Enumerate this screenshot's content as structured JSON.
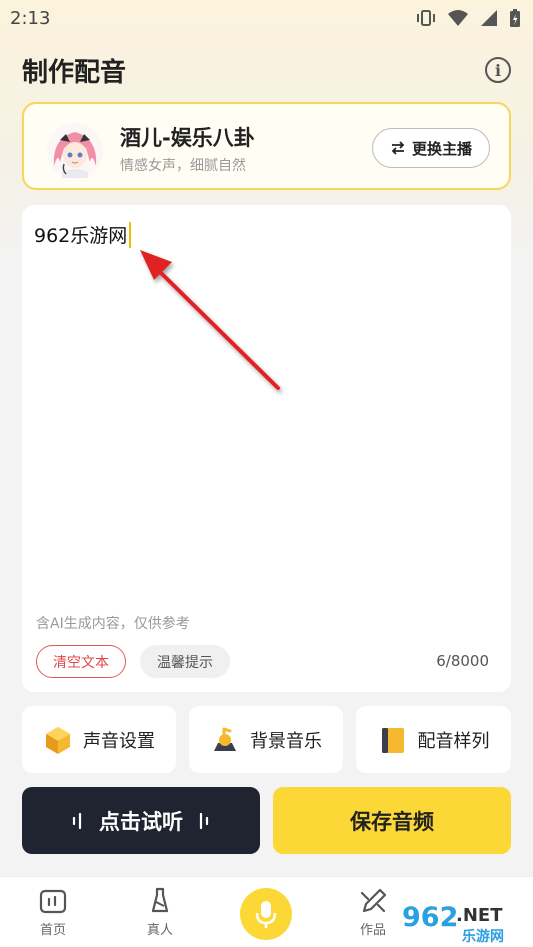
{
  "status_bar": {
    "time": "2:13"
  },
  "header": {
    "title": "制作配音",
    "info_label": "i"
  },
  "anchor": {
    "name": "酒儿-娱乐八卦",
    "description": "情感女声，细腻自然",
    "switch_label": "更换主播",
    "switch_icon": "swap-icon"
  },
  "editor": {
    "text": "962乐游网",
    "ai_note": "含AI生成内容，仅供参考",
    "clear_label": "清空文本",
    "tips_label": "温馨提示",
    "char_count": "6/8000"
  },
  "tools": [
    {
      "label": "声音设置",
      "icon": "voice-settings-icon"
    },
    {
      "label": "背景音乐",
      "icon": "background-music-icon"
    },
    {
      "label": "配音样列",
      "icon": "sample-book-icon"
    }
  ],
  "actions": {
    "listen_label": "点击试听",
    "save_label": "保存音频"
  },
  "tabbar": {
    "items": [
      {
        "label": "首页",
        "icon": "home-icon"
      },
      {
        "label": "真人",
        "icon": "person-icon"
      },
      {
        "label": "",
        "icon": "microphone-icon"
      },
      {
        "label": "作品",
        "icon": "pencil-icon"
      }
    ]
  },
  "watermark": {
    "text": "962.NET",
    "subtext": "乐游网"
  },
  "colors": {
    "accent": "#fcd836",
    "dark_button": "#1f2430",
    "clear_red": "#e04848",
    "annotation_arrow": "#e02020"
  }
}
